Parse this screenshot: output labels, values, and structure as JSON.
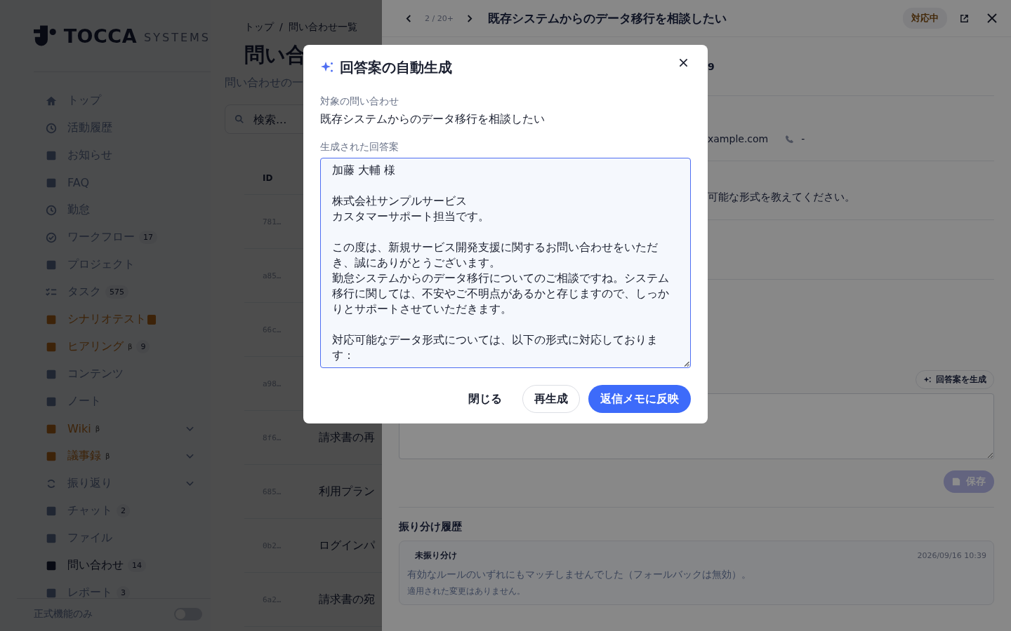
{
  "sidebar": {
    "logo": {
      "brand": "TOCCA",
      "sub": "SYSTEMS"
    },
    "items": [
      {
        "label": "トップ",
        "accent": false,
        "selected": false
      },
      {
        "label": "活動履歴",
        "accent": false,
        "selected": false
      },
      {
        "label": "お知らせ",
        "accent": false,
        "selected": false
      },
      {
        "label": "FAQ",
        "accent": false,
        "selected": false
      },
      {
        "label": "勤怠",
        "accent": false,
        "selected": false
      },
      {
        "label": "ワークフロー",
        "accent": false,
        "selected": false,
        "badge": "17"
      },
      {
        "label": "プロジェクト",
        "accent": false,
        "selected": false
      },
      {
        "label": "タスク",
        "accent": false,
        "selected": false,
        "badge": "575"
      },
      {
        "label": "シナリオテスト",
        "accent": true,
        "selected": false,
        "marked": true
      },
      {
        "label": "ヒアリング",
        "accent": true,
        "selected": false,
        "tag": "β",
        "badge": "9"
      },
      {
        "label": "コンテンツ",
        "accent": false,
        "selected": false
      },
      {
        "label": "ノート",
        "accent": false,
        "selected": false
      },
      {
        "label": "Wiki",
        "accent": true,
        "selected": false,
        "tag": "β",
        "expandable": true
      },
      {
        "label": "議事録",
        "accent": true,
        "selected": false,
        "tag": "β",
        "expandable": true
      },
      {
        "label": "振り返り",
        "accent": false,
        "selected": false,
        "expandable": true
      },
      {
        "label": "チャット",
        "accent": false,
        "selected": false,
        "badge": "2"
      },
      {
        "label": "ファイル",
        "accent": false,
        "selected": false
      },
      {
        "label": "問い合わせ",
        "accent": false,
        "selected": true,
        "badge": "14"
      },
      {
        "label": "レポート",
        "accent": false,
        "selected": false,
        "badge": "3"
      }
    ],
    "toggle": {
      "label": "正式機能のみ",
      "on": false
    }
  },
  "list": {
    "breadcrumb": [
      "トップ",
      "問い合わせ一覧"
    ],
    "breadcrumb_separator": "/",
    "title": "問い合",
    "subtitle": "問い合わせの一",
    "search": {
      "placeholder": "検索..."
    },
    "columns": [
      "ID"
    ],
    "rows": [
      {
        "id": "781…"
      },
      {
        "id": "a85…"
      },
      {
        "id": "66c…"
      },
      {
        "id": "a98…"
      },
      {
        "id": "8f6…",
        "subject": "請求書の再"
      },
      {
        "id": "685…",
        "subject": "利用プラン"
      },
      {
        "id": "0b2…",
        "subject": "ログインパ"
      },
      {
        "id": "6a2…",
        "subject": "請求書の宛"
      }
    ]
  },
  "detail": {
    "pager": "2 / 20+",
    "title": "既存システムからのデータ移行を相談したい",
    "status": "対応中",
    "number_fragment": "9",
    "email_fragment": "xample.com",
    "phone": "-",
    "message_fragment": "可能な形式を教えてください。",
    "memo": {
      "generate_button": "回答案を生成",
      "save_button": "保存",
      "save_disabled": true
    },
    "history": {
      "title": "振り分け履歴",
      "entries": [
        {
          "label": "未振り分け",
          "time": "2026/09/16 10:39",
          "message": "有効なルールのいずれにもマッチしませんでした（フォールバックは無効）。",
          "note": "適用された変更はありません。"
        }
      ]
    }
  },
  "modal": {
    "title": "回答案の自動生成",
    "target_label": "対象の問い合わせ",
    "target": "既存システムからのデータ移行を相談したい",
    "answer_label": "生成された回答案",
    "answer": [
      [
        "加藤 大輔 様"
      ],
      [
        "株式会社サンプルサービス",
        "カスタマーサポート担当です。"
      ],
      [
        "この度は、新規サービス開発支援に関するお問い合わせをいただき、誠にありがとうございます。",
        "勤怠システムからのデータ移行についてのご相談ですね。システム移行に関しては、不安やご不明点があるかと存じますので、しっかりとサポートさせていただきます。"
      ],
      [
        "対応可能なデータ形式については、以下の形式に対応しております："
      ]
    ],
    "buttons": [
      {
        "label": "閉じる",
        "kind": "text"
      },
      {
        "label": "再生成",
        "kind": "outline"
      },
      {
        "label": "返信メモに反映",
        "kind": "primary"
      }
    ]
  }
}
